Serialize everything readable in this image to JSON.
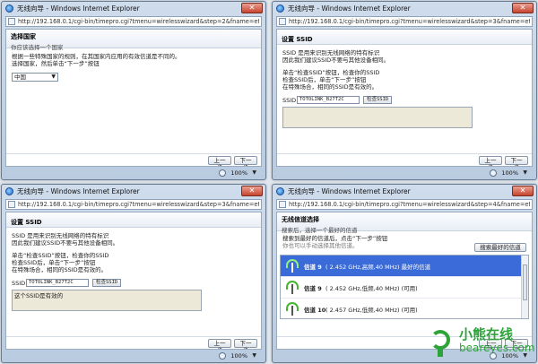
{
  "colors": {
    "accent": "#3a6bd8",
    "watermark": "#2ea33a",
    "close": "#c7442f"
  },
  "windows": [
    {
      "title": "无线向导 - Windows Internet Explorer",
      "url": "http://192.168.0.1/cgi-bin/timepro.cgi?tmenu=wirelesswizard&step=2&fname=eth0",
      "header_title": "选择国家",
      "header_sub": "你应该选择一个国家",
      "paragraphs": [
        "根据一些特殊国家的规则，在其国家内应用的有效信道是不同的。",
        "选择国家，然后单击“下一步”按钮"
      ],
      "country": "中国",
      "back": "上一步",
      "next": "下一步",
      "zoom": "100%"
    },
    {
      "title": "无线向导 - Windows Internet Explorer",
      "url": "http://192.168.0.1/cgi-bin/timepro.cgi?tmenu=wirelesswizard&step=3&fname=eth0&cc",
      "header_title": "设置 SSID",
      "p1a": "SSID 是用来识别无线网络的特有标识",
      "p1b": "因此我们建议SSID不要与其他设备相同。",
      "p2a": "单击“检查SSID”按钮，检查你的SSID",
      "p2b": "检查SSID后，单击“下一步”按钮",
      "p2c": "在特殊场合，相同的SSID是有效的。",
      "ssid_label": "SSID",
      "ssid_value": "TOTOLINK_B27T2C",
      "check_btn": "检查SSID",
      "message": "",
      "back": "上一步",
      "next": "下一步",
      "zoom": "100%"
    },
    {
      "title": "无线向导 - Windows Internet Explorer",
      "url": "http://192.168.0.1/cgi-bin/timepro.cgi?tmenu=wirelesswizard&step=3&fname=eth0&cc",
      "header_title": "设置 SSID",
      "p1a": "SSID 是用来识别无线网络的特有标识",
      "p1b": "因此我们建议SSID不要与其他设备相同。",
      "p2a": "单击“检查SSID”按钮，检查你的SSID",
      "p2b": "检查SSID后，单击“下一步”按钮",
      "p2c": "在特殊场合，相同的SSID是有效的。",
      "ssid_label": "SSID",
      "ssid_value": "TOTOLINK_B27T2C",
      "check_btn": "检查SSID",
      "message": "这个SSID是有效的",
      "back": "上一步",
      "next": "下一步",
      "zoom": "100%"
    },
    {
      "title": "无线向导 - Windows Internet Explorer",
      "url": "http://192.168.0.1/cgi-bin/timepro.cgi?tmenu=wirelesswizard&step=4&fname=eth0&cc",
      "header_title": "无线信道选择",
      "header_sub": "搜索后，选择一个最好的信道",
      "intro": "搜索到最好的信道后，点击“下一步”按钮",
      "note": "你也可以手动选择其他信道。",
      "scan_btn": "搜索最好的信道",
      "channels": [
        {
          "name": "信道 9",
          "info": "( 2.452 GHz,高频,40 MHz) 最好的信道",
          "selected": true
        },
        {
          "name": "信道 9",
          "info": "( 2.452 GHz,低频,40 MHz) (可用)",
          "selected": false
        },
        {
          "name": "信道 10",
          "info": "( 2.457 GHz,低频,40 MHz) (可用)",
          "selected": false
        }
      ],
      "back": "上一步",
      "next": "下一步",
      "zoom": "100%"
    }
  ],
  "watermark": {
    "line1": "小熊在线",
    "line2": "beareyes.com"
  }
}
